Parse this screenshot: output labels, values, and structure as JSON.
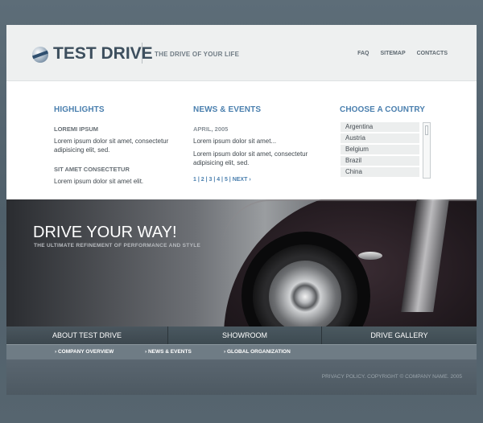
{
  "header": {
    "logo_text": "TEST DRIVE",
    "tagline": "THE DRIVE OF YOUR LIFE",
    "nav": [
      "FAQ",
      "SITEMAP",
      "CONTACTS"
    ]
  },
  "highlights": {
    "title": "HIGHLIGHTS",
    "items": [
      {
        "heading": "LOREMI IPSUM",
        "text": "Lorem ipsum dolor sit amet, consectetur adipisicing elit, sed."
      },
      {
        "heading": "SIT AMET CONSECTETUR",
        "text": "Lorem ipsum dolor sit amet elit."
      }
    ]
  },
  "news": {
    "title": "NEWS & EVENTS",
    "date": "APRIL, 2005",
    "text1": "Lorem ipsum dolor sit amet...",
    "text2": "Lorem ipsum dolor sit amet, consectetur adipisicing elit, sed.",
    "pager": "1 | 2 | 3 | 4 | 5 |  NEXT ›"
  },
  "countries": {
    "title": "CHOOSE A COUNTRY",
    "items": [
      "Argentina",
      "Austria",
      "Belgium",
      "Brazil",
      "China"
    ]
  },
  "banner": {
    "title": "DRIVE YOUR WAY!",
    "subtitle": "THE ULTIMATE REFINEMENT OF PERFORMANCE AND STYLE"
  },
  "main_nav": [
    "ABOUT TEST DRIVE",
    "SHOWROOM",
    "DRIVE GALLERY"
  ],
  "sub_nav": [
    "› COMPANY OVERVIEW",
    "› NEWS &  EVENTS",
    "› GLOBAL ORGANIZATION"
  ],
  "footer": {
    "copyright": "PRIVACY POLICY. COPYRIGHT © COMPANY NAME. 2005"
  }
}
